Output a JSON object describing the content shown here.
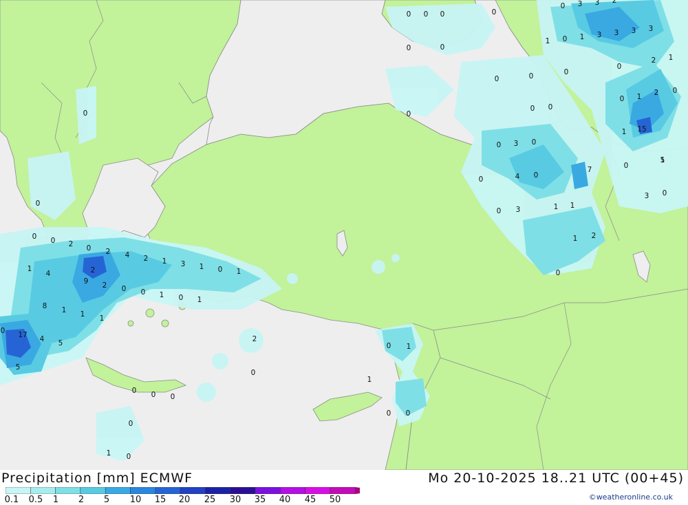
{
  "title": "Precipitation [mm] ECMWF",
  "valid_time": "Mo 20-10-2025 18..21 UTC (00+45)",
  "credit": "©weatheronline.co.uk",
  "colors": {
    "sea": "#eeeeee",
    "land": "#c2f29a",
    "border": "#8a8a8a"
  },
  "legend": {
    "ticks": [
      "0.1",
      "0.5",
      "1",
      "2",
      "5",
      "10",
      "15",
      "20",
      "25",
      "30",
      "35",
      "40",
      "45",
      "50"
    ],
    "colors": [
      "#c8f5f5",
      "#a7ecef",
      "#7fdfe6",
      "#58cbe3",
      "#3aa9e2",
      "#2b86dd",
      "#2664d5",
      "#2241c3",
      "#1c22a6",
      "#2a0f96",
      "#7b11e0",
      "#b30fe6",
      "#d90ee6",
      "#c40bb8",
      "#a3087f"
    ]
  },
  "values": [
    "0",
    "0",
    "0",
    "0",
    "0",
    "3",
    "3",
    "2",
    "0",
    "0",
    "1",
    "0",
    "1",
    "3",
    "3",
    "3",
    "3",
    "0",
    "2",
    "1",
    "0",
    "0",
    "0",
    "0",
    "0",
    "2",
    "0",
    "0",
    "1",
    "0",
    "0",
    "0",
    "1",
    "15",
    "0",
    "3",
    "0",
    "1",
    "5",
    "0",
    "4",
    "0",
    "7",
    "0",
    "3",
    "0",
    "1",
    "3",
    "1",
    "1",
    "2",
    "0",
    "0",
    "0",
    "0",
    "2",
    "0",
    "2",
    "4",
    "2",
    "1",
    "3",
    "1",
    "0",
    "1",
    "1",
    "4",
    "2",
    "9",
    "2",
    "0",
    "0",
    "1",
    "0",
    "1",
    "8",
    "1",
    "1",
    "1",
    "17",
    "4",
    "5",
    "5",
    "2",
    "0",
    "0",
    "1",
    "1",
    "0",
    "0",
    "0",
    "0",
    "0",
    "1",
    "0",
    "0",
    "0",
    "0"
  ]
}
